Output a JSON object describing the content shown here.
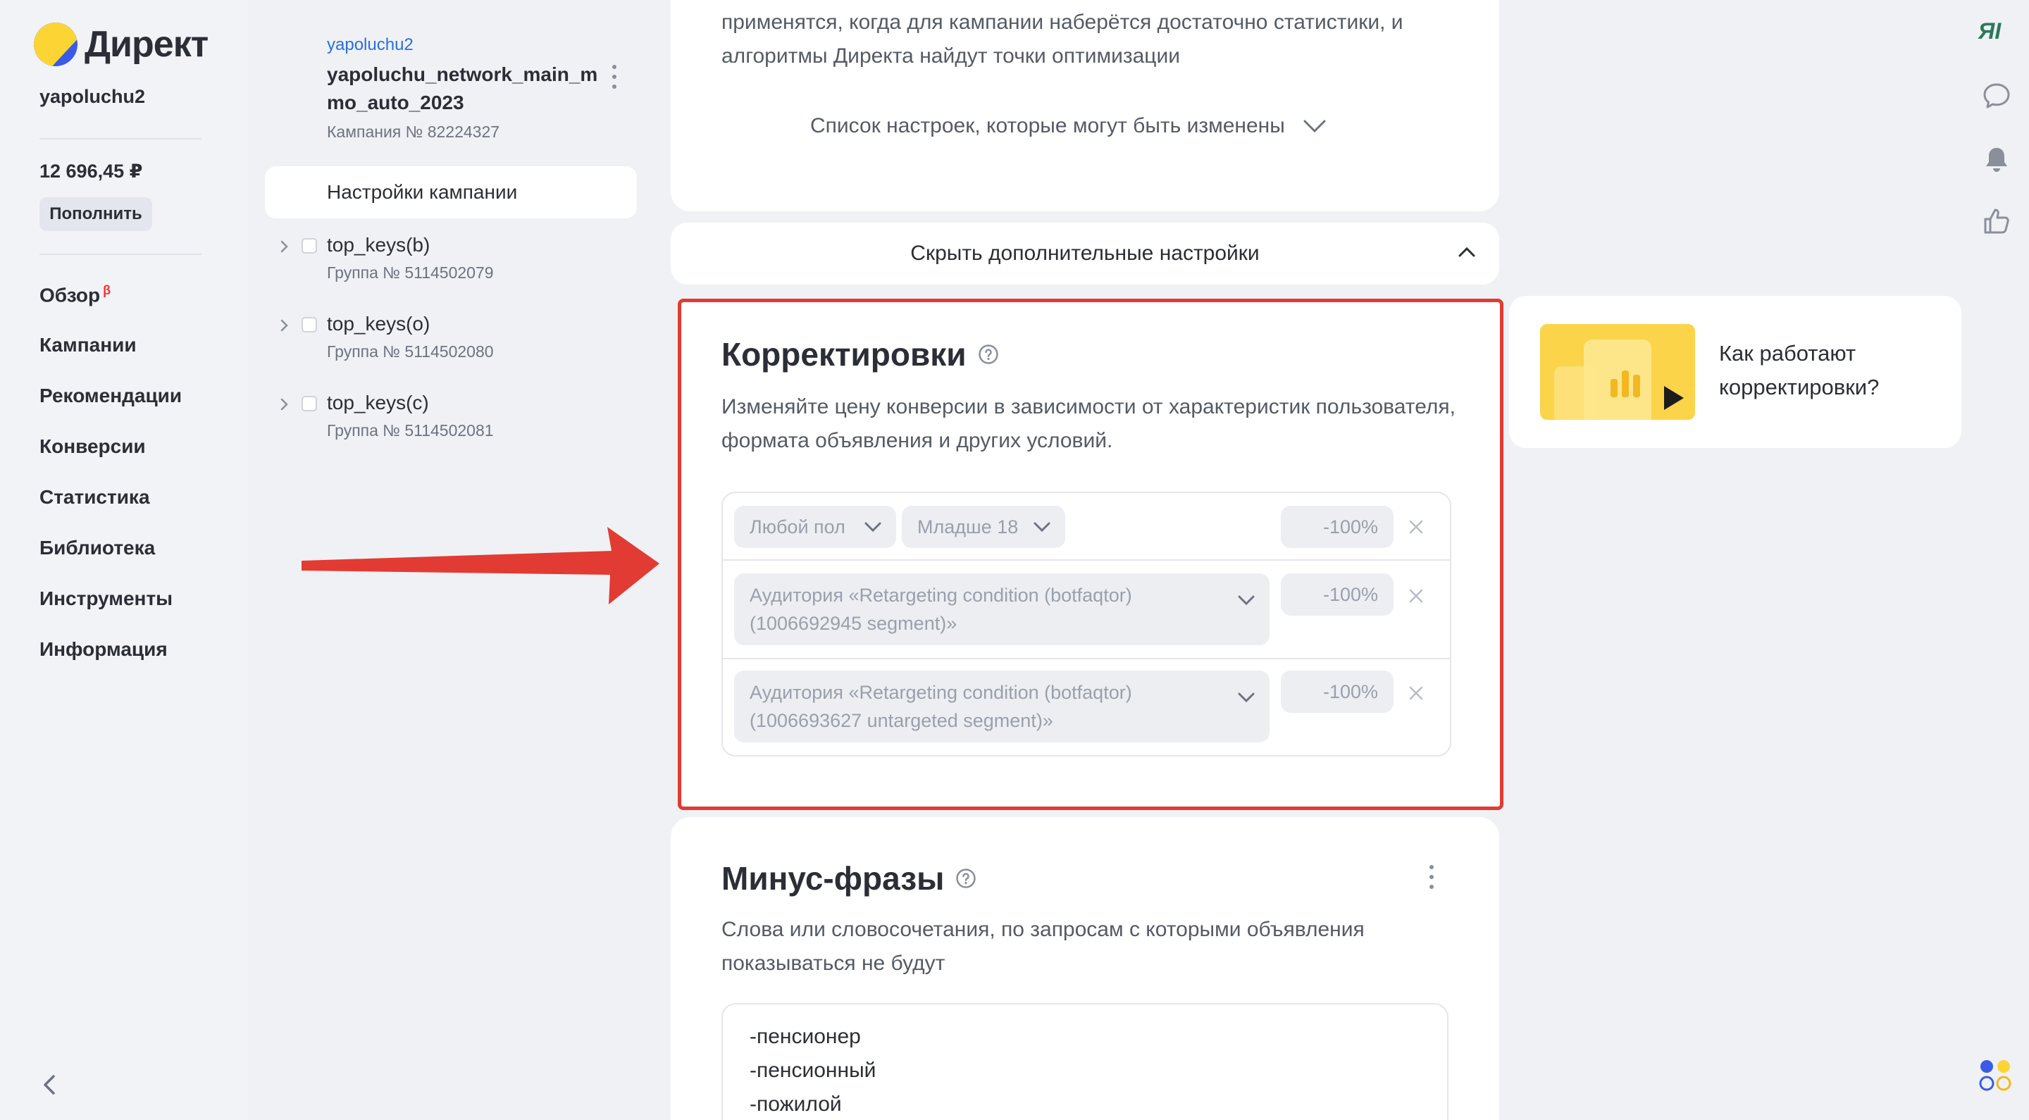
{
  "nav": {
    "logo_text": "Директ",
    "login": "yapoluchu2",
    "balance": "12 696,45 ₽",
    "topup_label": "Пополнить",
    "items": [
      {
        "label": "Обзор",
        "badge": "β"
      },
      {
        "label": "Кампании"
      },
      {
        "label": "Рекомендации"
      },
      {
        "label": "Конверсии"
      },
      {
        "label": "Статистика"
      },
      {
        "label": "Библиотека"
      },
      {
        "label": "Инструменты"
      },
      {
        "label": "Информация"
      }
    ]
  },
  "tree": {
    "login": "yapoluchu2",
    "campaign_name": "yapoluchu_network_main_mmo_auto_2023",
    "campaign_number": "Кампания № 82224327",
    "settings_label": "Настройки кампании",
    "groups": [
      {
        "name": "top_keys(b)",
        "number": "Группа № 5114502079"
      },
      {
        "name": "top_keys(o)",
        "number": "Группа № 5114502080"
      },
      {
        "name": "top_keys(c)",
        "number": "Группа № 5114502081"
      }
    ]
  },
  "main": {
    "top_text": "применятся, когда для кампании наберётся достаточно статистики, и алгоритмы Директа найдут точки оптимизации",
    "settings_list_label": "Список настроек, которые могут быть изменены",
    "hide_settings_label": "Скрыть дополнительные настройки",
    "adjustments": {
      "title": "Корректировки",
      "description": "Изменяйте цену конверсии в зависимости от характеристик пользователя, формата объявления и других условий.",
      "rows": [
        {
          "gender": "Любой пол",
          "age": "Младше 18",
          "value": "-100%"
        },
        {
          "audience": "Аудитория «Retargeting condition (botfaqtor) (1006692945 segment)»",
          "value": "-100%"
        },
        {
          "audience": "Аудитория «Retargeting condition (botfaqtor) (1006693627 untargeted segment)»",
          "value": "-100%"
        }
      ]
    },
    "minus_phrases": {
      "title": "Минус-фразы",
      "description": "Слова или словосочетания, по запросам с которыми объявления показываться не будут",
      "phrases": [
        "-пенсионер",
        "-пенсионный",
        "-пожилой"
      ]
    }
  },
  "promo": {
    "video_text": "Как работают корректировки?"
  },
  "rail": {
    "ya_label": "ЯI"
  },
  "colors": {
    "highlight_border": "#e23b33",
    "arrow": "#e23b33",
    "link": "#2a6fe0",
    "logo_yellow": "#fcd535",
    "logo_blue": "#3a5be8"
  }
}
